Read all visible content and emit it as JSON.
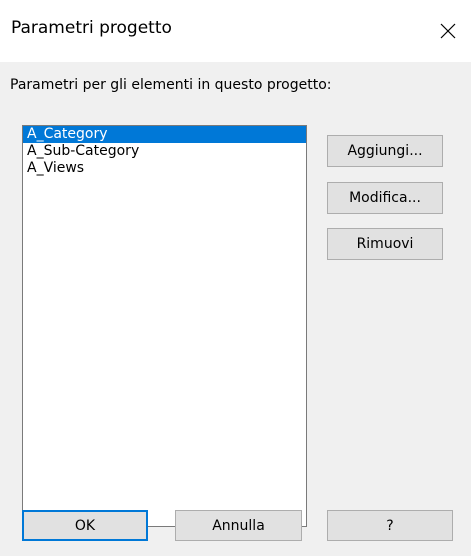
{
  "window": {
    "title": "Parametri progetto"
  },
  "prompt": "Parametri per gli elementi in questo progetto:",
  "parameters": {
    "items": [
      {
        "label": "A_Category",
        "selected": true
      },
      {
        "label": "A_Sub-Category",
        "selected": false
      },
      {
        "label": "A_Views",
        "selected": false
      }
    ]
  },
  "side_buttons": {
    "add": "Aggiungi...",
    "edit": "Modifica...",
    "remove": "Rimuovi"
  },
  "bottom_buttons": {
    "ok": "OK",
    "cancel": "Annulla",
    "help": "?"
  },
  "colors": {
    "selection": "#0078d7",
    "button_face": "#e1e1e1",
    "dialog_bg": "#f0f0f0"
  }
}
